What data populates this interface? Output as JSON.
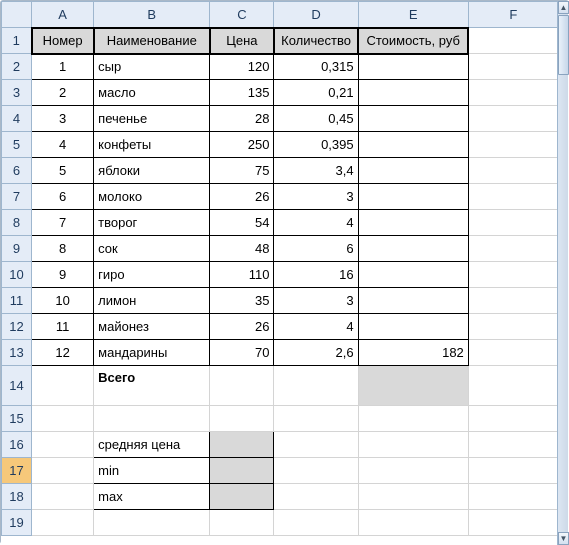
{
  "columns": [
    "A",
    "B",
    "C",
    "D",
    "E",
    "F"
  ],
  "row_headers": [
    "1",
    "2",
    "3",
    "4",
    "5",
    "6",
    "7",
    "8",
    "9",
    "10",
    "11",
    "12",
    "13",
    "14",
    "15",
    "16",
    "17",
    "18",
    "19"
  ],
  "selected_row": "17",
  "headers": {
    "A": "Номер",
    "B": "Наименование",
    "C": "Цена",
    "D": "Количество",
    "E": "Стоимость, руб"
  },
  "rows": [
    {
      "n": "1",
      "name": "сыр",
      "price": "120",
      "qty": "0,315",
      "cost": ""
    },
    {
      "n": "2",
      "name": "масло",
      "price": "135",
      "qty": "0,21",
      "cost": ""
    },
    {
      "n": "3",
      "name": "печенье",
      "price": "28",
      "qty": "0,45",
      "cost": ""
    },
    {
      "n": "4",
      "name": "конфеты",
      "price": "250",
      "qty": "0,395",
      "cost": ""
    },
    {
      "n": "5",
      "name": "яблоки",
      "price": "75",
      "qty": "3,4",
      "cost": ""
    },
    {
      "n": "6",
      "name": "молоко",
      "price": "26",
      "qty": "3",
      "cost": ""
    },
    {
      "n": "7",
      "name": "творог",
      "price": "54",
      "qty": "4",
      "cost": ""
    },
    {
      "n": "8",
      "name": "сок",
      "price": "48",
      "qty": "6",
      "cost": ""
    },
    {
      "n": "9",
      "name": "гиро",
      "price": "110",
      "qty": "16",
      "cost": ""
    },
    {
      "n": "10",
      "name": "лимон",
      "price": "35",
      "qty": "3",
      "cost": ""
    },
    {
      "n": "11",
      "name": "майонез",
      "price": "26",
      "qty": "4",
      "cost": ""
    },
    {
      "n": "12",
      "name": "мандарины",
      "price": "70",
      "qty": "2,6",
      "cost": "182"
    }
  ],
  "total_label": "Всего",
  "stats": {
    "avg": "средняя цена",
    "min": "min",
    "max": "max"
  },
  "chart_data": {
    "type": "table",
    "columns": [
      "Номер",
      "Наименование",
      "Цена",
      "Количество",
      "Стоимость, руб"
    ],
    "data": [
      [
        1,
        "сыр",
        120,
        0.315,
        null
      ],
      [
        2,
        "масло",
        135,
        0.21,
        null
      ],
      [
        3,
        "печенье",
        28,
        0.45,
        null
      ],
      [
        4,
        "конфеты",
        250,
        0.395,
        null
      ],
      [
        5,
        "яблоки",
        75,
        3.4,
        null
      ],
      [
        6,
        "молоко",
        26,
        3,
        null
      ],
      [
        7,
        "творог",
        54,
        4,
        null
      ],
      [
        8,
        "сок",
        48,
        6,
        null
      ],
      [
        9,
        "гиро",
        110,
        16,
        null
      ],
      [
        10,
        "лимон",
        35,
        3,
        null
      ],
      [
        11,
        "майонез",
        26,
        4,
        null
      ],
      [
        12,
        "мандарины",
        70,
        2.6,
        182
      ]
    ]
  }
}
